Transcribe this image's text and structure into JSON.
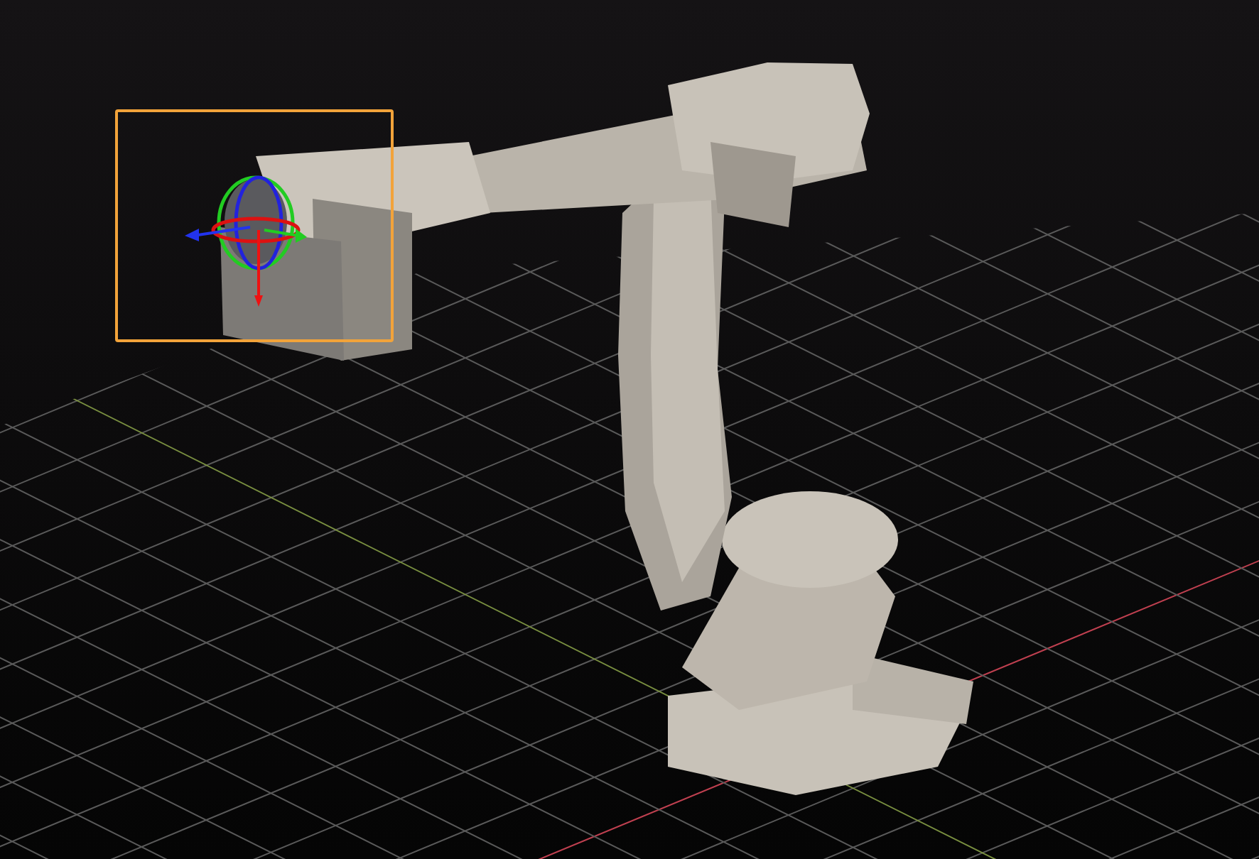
{
  "viewport": {
    "grid_visible": true,
    "selection_box_visible": true,
    "transform_gizmo_visible": true
  }
}
